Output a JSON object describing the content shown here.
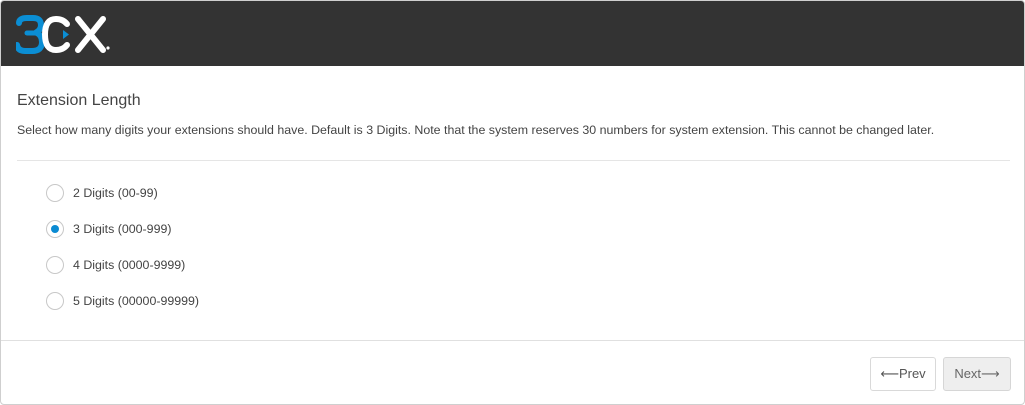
{
  "header": {
    "logo_text": "3CX",
    "brand_blue": "#0b8ed4",
    "background": "#333333"
  },
  "main": {
    "title": "Extension Length",
    "description": "Select how many digits your extensions should have. Default is 3 Digits. Note that the system reserves 30 numbers for system extension. This cannot be changed later.",
    "options": [
      {
        "label": "2 Digits (00-99)",
        "checked": false
      },
      {
        "label": "3 Digits (000-999)",
        "checked": true
      },
      {
        "label": "4 Digits (0000-9999)",
        "checked": false
      },
      {
        "label": "5 Digits (00000-99999)",
        "checked": false
      }
    ],
    "selected_color": "#0a8ad2"
  },
  "footer": {
    "prev_label": "⟵Prev",
    "next_label": "Next⟶"
  }
}
